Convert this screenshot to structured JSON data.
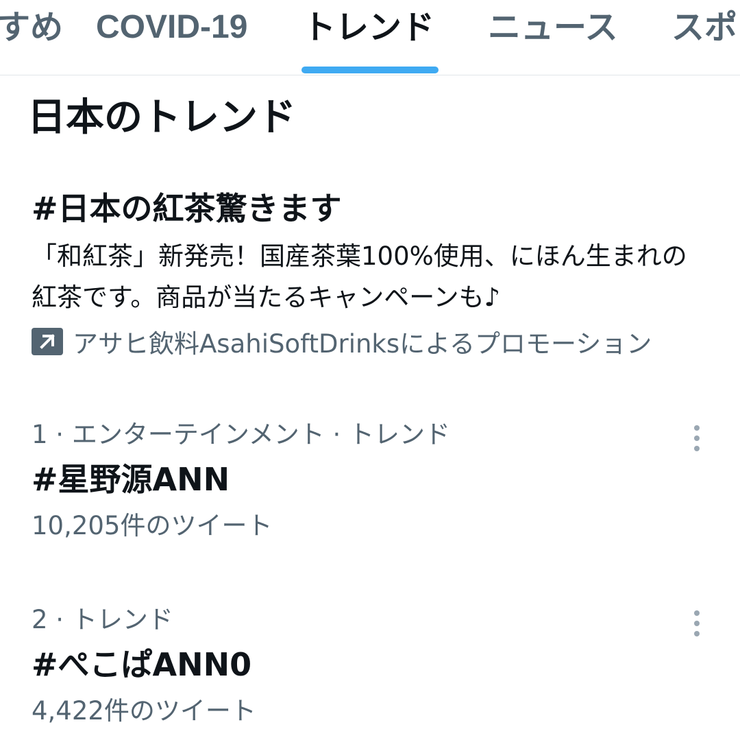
{
  "tabs": [
    {
      "label": "すめ"
    },
    {
      "label": "COVID-19"
    },
    {
      "label": "トレンド",
      "active": true
    },
    {
      "label": "ニュース"
    },
    {
      "label": "スポ"
    }
  ],
  "section_title": "日本のトレンド",
  "promoted": {
    "hashtag": "#日本の紅茶驚きます",
    "description": "「和紅茶」新発売！国産茶葉100%使用、にほん生まれの紅茶です。商品が当たるキャンペーンも♪",
    "promoted_by": "アサヒ飲料AsahiSoftDrinksによるプロモーション",
    "icon": "promoted-arrow-icon"
  },
  "trends": [
    {
      "meta": "1 · エンターテインメント · トレンド",
      "name": "#星野源ANN",
      "count": "10,205件のツイート"
    },
    {
      "meta": "2 · トレンド",
      "name": "#ぺこぱANN0",
      "count": "4,422件のツイート"
    }
  ],
  "colors": {
    "accent": "#1d9bf0",
    "primary_text": "#0f1419",
    "secondary_text": "#536471",
    "divider": "#e1e6ea"
  }
}
